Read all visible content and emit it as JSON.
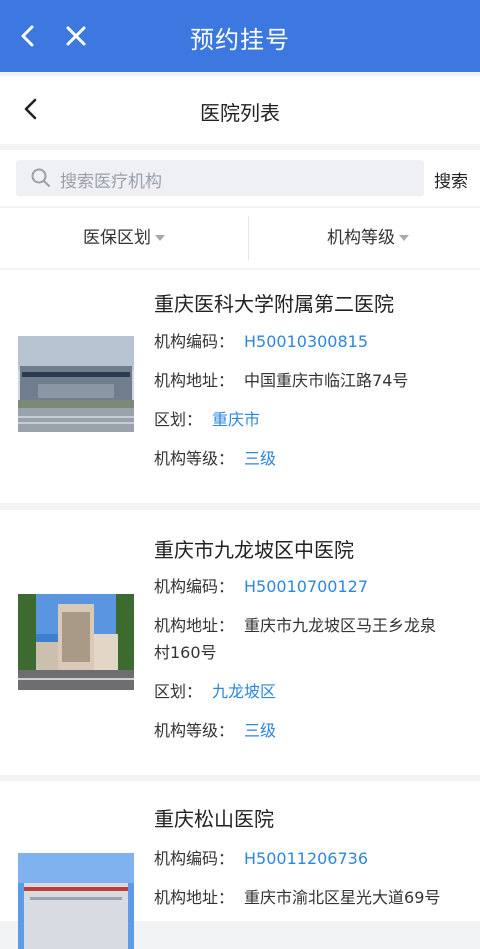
{
  "topbar": {
    "title": "预约挂号"
  },
  "subbar": {
    "title": "医院列表"
  },
  "search": {
    "placeholder": "搜索医疗机构",
    "button": "搜索"
  },
  "filters": [
    {
      "label": "医保区划"
    },
    {
      "label": "机构等级"
    }
  ],
  "labels": {
    "code": "机构编码：",
    "address": "机构地址：",
    "district": "区划：",
    "level": "机构等级："
  },
  "hospitals": [
    {
      "name": "重庆医科大学附属第二医院",
      "code": "H50010300815",
      "address": "中国重庆市临江路74号",
      "district": "重庆市",
      "level": "三级"
    },
    {
      "name": "重庆市九龙坡区中医院",
      "code": "H50010700127",
      "address_line1": "重庆市九龙坡区马王乡龙泉",
      "address_line2": "村160号",
      "district": "九龙坡区",
      "level": "三级"
    },
    {
      "name": "重庆松山医院",
      "code": "H50011206736",
      "address": "重庆市渝北区星光大道69号"
    }
  ],
  "colors": {
    "accent": "#3d78e0",
    "link": "#2d86e0"
  }
}
